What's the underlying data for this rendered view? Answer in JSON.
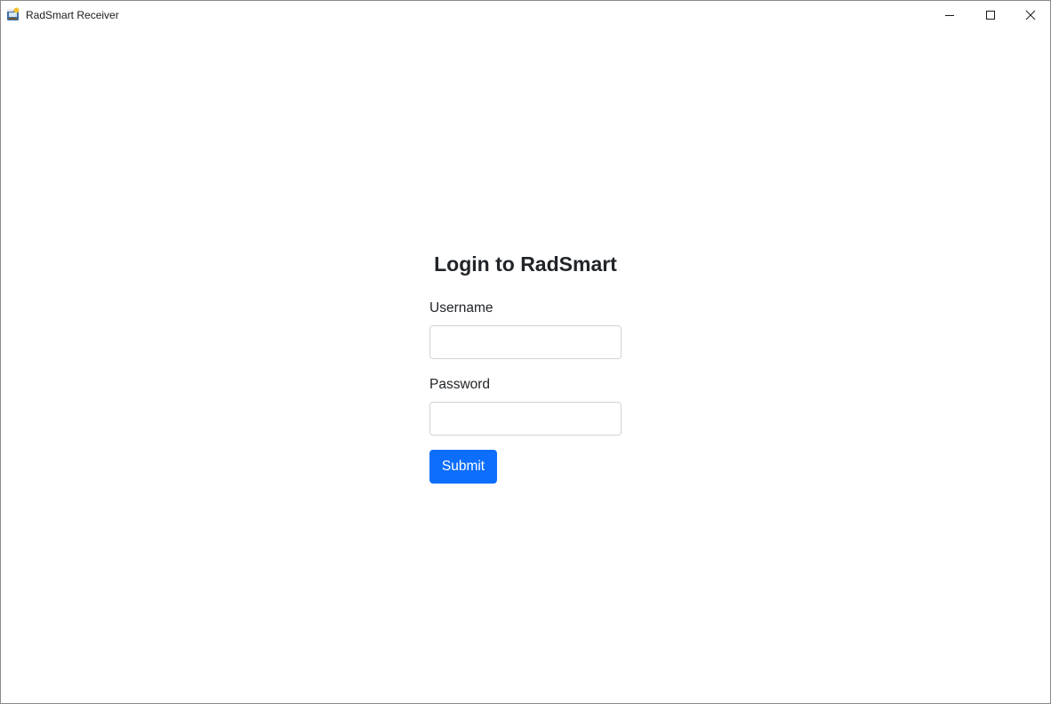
{
  "window": {
    "title": "RadSmart Receiver",
    "app_icon": "radsmart-app-icon",
    "controls": {
      "minimize_icon": "minimize-icon",
      "maximize_icon": "maximize-icon",
      "close_icon": "close-icon"
    }
  },
  "login": {
    "title": "Login to RadSmart",
    "username_label": "Username",
    "username_value": "",
    "password_label": "Password",
    "password_value": "",
    "submit_label": "Submit"
  },
  "colors": {
    "primary": "#0d6efd",
    "text": "#212529",
    "input_border": "#ced4da",
    "background": "#ffffff"
  }
}
